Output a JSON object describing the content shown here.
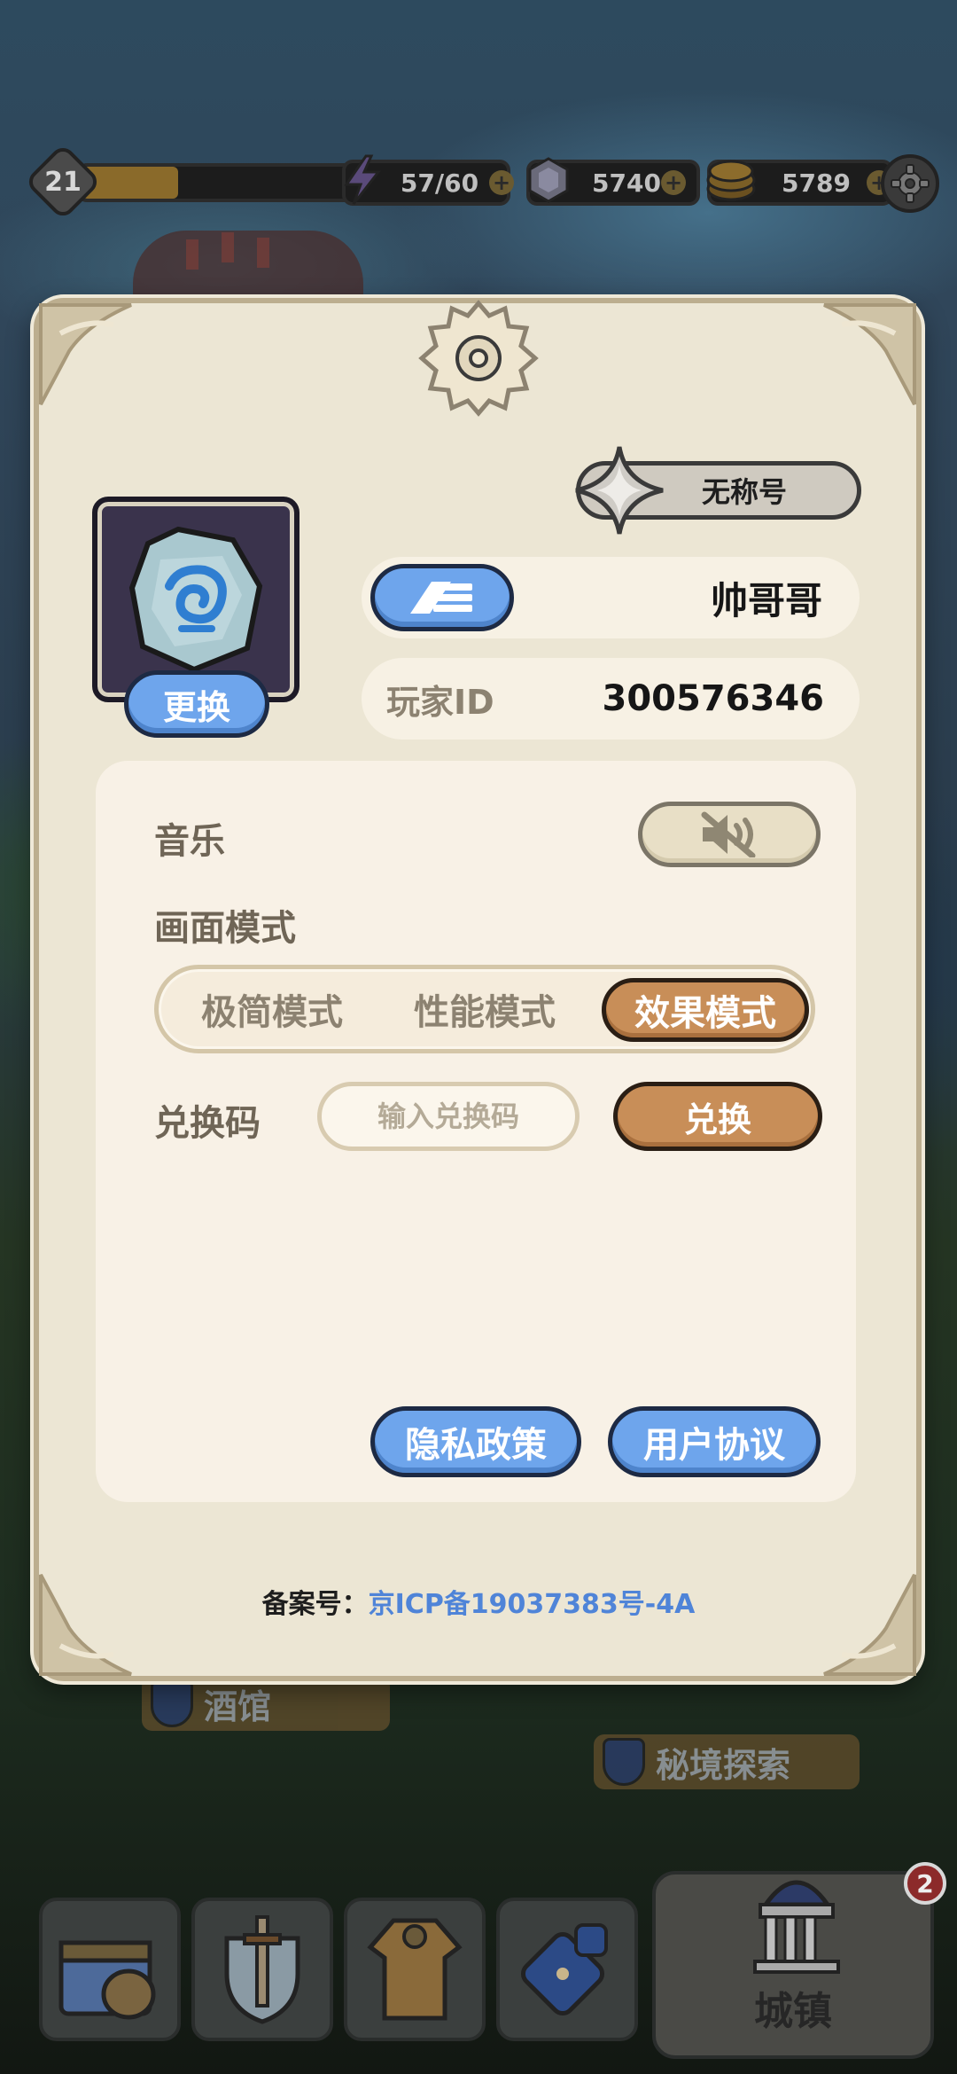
{
  "hud": {
    "level": "21",
    "xp_fraction": 0.36,
    "energy": "57/60",
    "gems": "5740",
    "gold": "5789"
  },
  "profile": {
    "title_badge": "无称号",
    "avatar_change_label": "更换",
    "nickname": "帅哥哥",
    "player_id_label": "玩家ID",
    "player_id": "300576346"
  },
  "settings": {
    "music_label": "音乐",
    "music_state_icon": "speaker-muted-icon",
    "display_mode_label": "画面模式",
    "display_modes": [
      "极简模式",
      "性能模式",
      "效果模式"
    ],
    "display_mode_selected": "效果模式",
    "redeem_label": "兑换码",
    "redeem_placeholder": "输入兑换码",
    "redeem_button": "兑换",
    "privacy_button": "隐私政策",
    "agreement_button": "用户协议"
  },
  "footer": {
    "icp_label": "备案号：",
    "icp_number": "京ICP备19037383号-4A"
  },
  "scene": {
    "tavern_label": "酒馆",
    "secret_explore_label": "秘境探索"
  },
  "bottom_nav": {
    "town_label": "城镇",
    "town_badge": "2"
  },
  "colors": {
    "panel_bg": "#ece6d4",
    "accent_blue": "#6ea5ec",
    "accent_orange": "#c88e58",
    "link_blue": "#4f84d8"
  }
}
